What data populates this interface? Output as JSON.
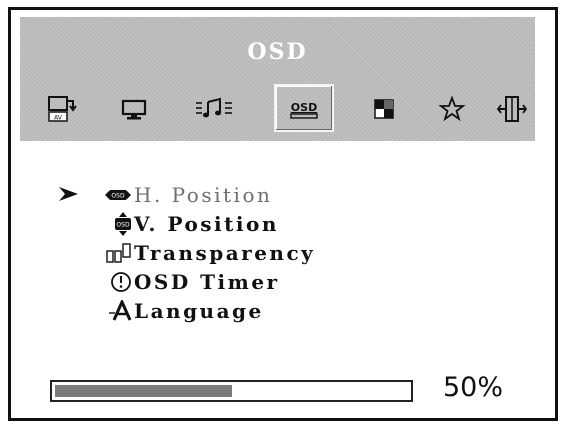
{
  "header": {
    "title": "OSD",
    "icons": [
      {
        "name": "input-source-icon"
      },
      {
        "name": "display-icon"
      },
      {
        "name": "audio-icon"
      },
      {
        "name": "osd-icon",
        "label": "OSD",
        "selected": true
      },
      {
        "name": "color-icon"
      },
      {
        "name": "favorite-icon"
      },
      {
        "name": "exit-icon"
      }
    ]
  },
  "menu": {
    "items": [
      {
        "label": "H. Position",
        "icon": "h-position-icon",
        "active": true
      },
      {
        "label": "V. Position",
        "icon": "v-position-icon"
      },
      {
        "label": "Transparency",
        "icon": "transparency-icon"
      },
      {
        "label": "OSD Timer",
        "icon": "timer-icon"
      },
      {
        "label": "Language",
        "icon": "language-icon"
      }
    ]
  },
  "adjustment": {
    "value_text": "50%",
    "value": 0.5
  }
}
